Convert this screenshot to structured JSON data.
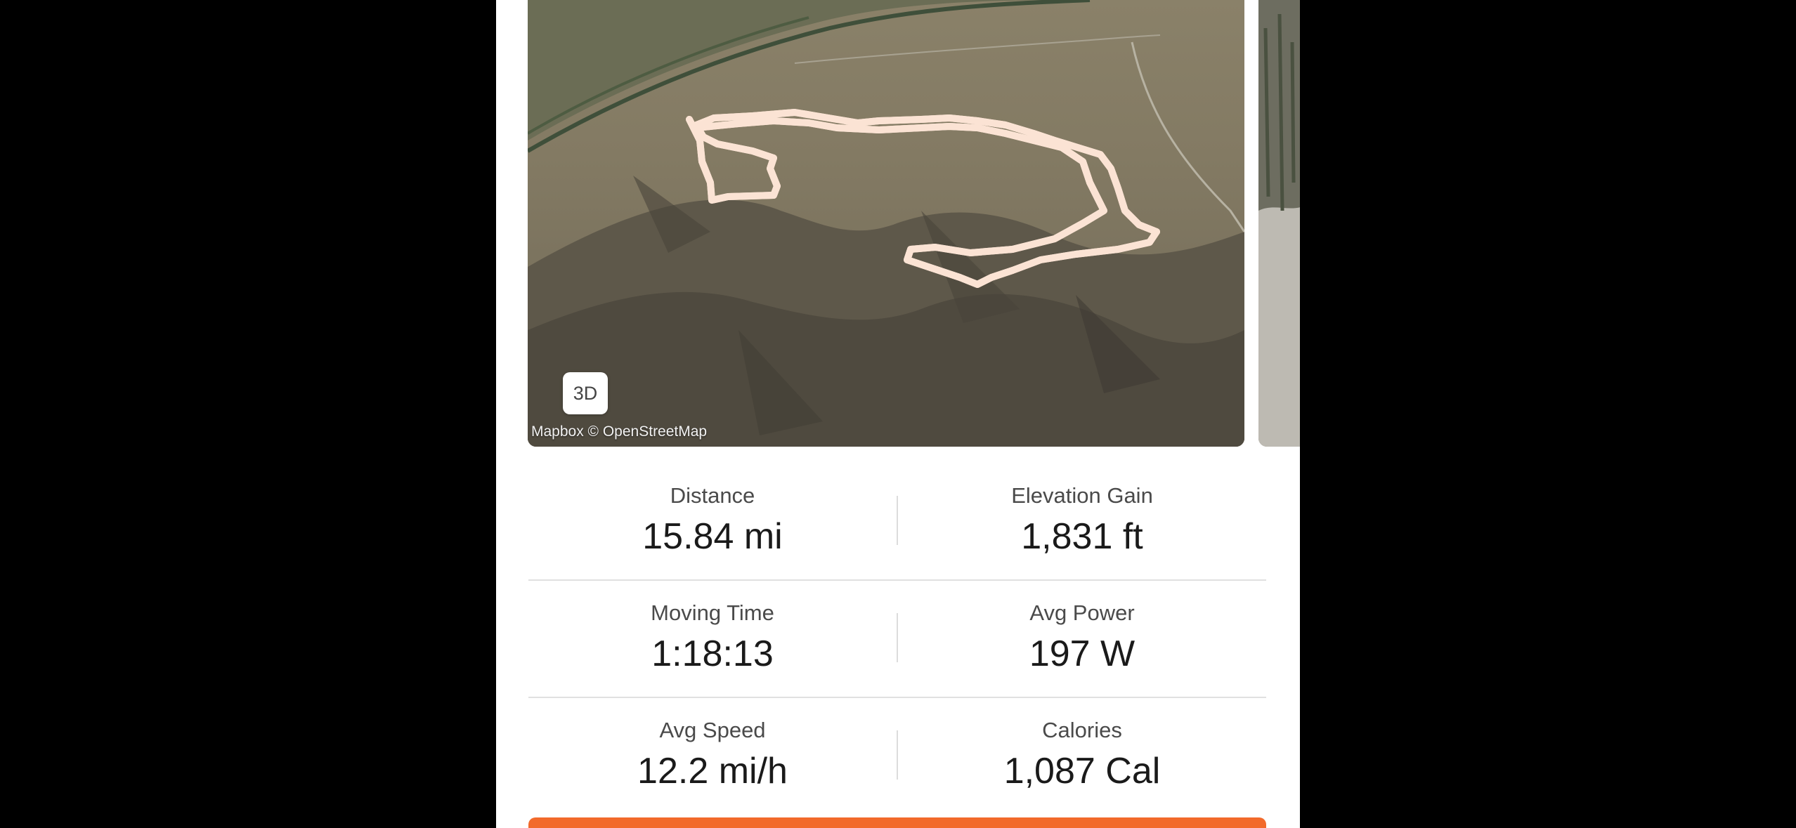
{
  "map": {
    "toggle_3d_label": "3D",
    "attribution": "Mapbox © OpenStreetMap",
    "route_color": "#f2743a"
  },
  "stats": {
    "distance": {
      "label": "Distance",
      "value": "15.84 mi"
    },
    "elevation_gain": {
      "label": "Elevation Gain",
      "value": "1,831 ft"
    },
    "moving_time": {
      "label": "Moving Time",
      "value": "1:18:13"
    },
    "avg_power": {
      "label": "Avg Power",
      "value": "197 W"
    },
    "avg_speed": {
      "label": "Avg Speed",
      "value": "12.2 mi/h"
    },
    "calories": {
      "label": "Calories",
      "value": "1,087 Cal"
    }
  },
  "colors": {
    "accent": "#f26a2b",
    "background": "#ffffff",
    "letterbox": "#000000"
  }
}
